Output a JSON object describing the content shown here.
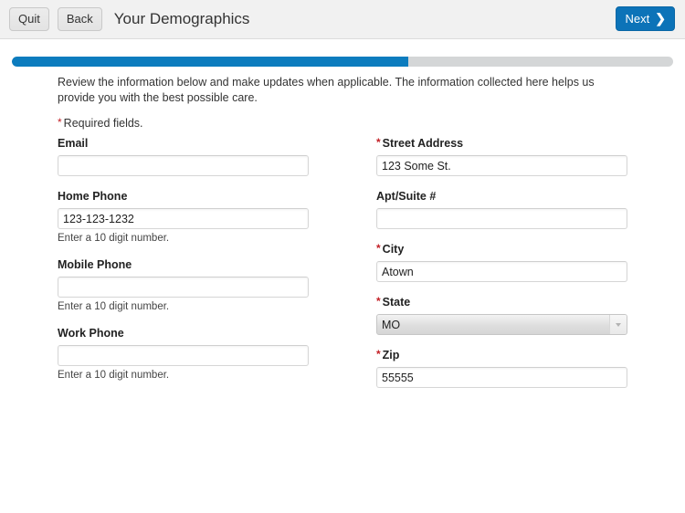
{
  "header": {
    "quit_label": "Quit",
    "back_label": "Back",
    "title": "Your Demographics",
    "next_label": "Next",
    "next_icon": "chevron-right-icon"
  },
  "progress": {
    "percent": 60,
    "fill_color": "#0c7cbe",
    "track_color": "#d4d6d7"
  },
  "intro": {
    "text": "Review the information below and make updates when applicable. The information collected here helps us provide you with the best possible care.",
    "required_note": "Required fields.",
    "required_marker": "*",
    "required_color": "#c32026"
  },
  "left_column": {
    "fields": [
      {
        "label": "Email",
        "required": false,
        "value": "",
        "placeholder": "",
        "helper": ""
      },
      {
        "label": "Home Phone",
        "required": false,
        "value": "123-123-1232",
        "placeholder": "",
        "helper": "Enter a 10 digit number."
      },
      {
        "label": "Mobile Phone",
        "required": false,
        "value": "",
        "placeholder": "",
        "helper": "Enter a 10 digit number."
      },
      {
        "label": "Work Phone",
        "required": false,
        "value": "",
        "placeholder": "",
        "helper": "Enter a 10 digit number."
      }
    ]
  },
  "right_column": {
    "fields": [
      {
        "label": "Street Address",
        "required": true,
        "value": "123 Some St.",
        "placeholder": "",
        "helper": ""
      },
      {
        "label": "Apt/Suite #",
        "required": false,
        "value": "",
        "placeholder": "",
        "helper": ""
      },
      {
        "label": "City",
        "required": true,
        "value": "Atown",
        "placeholder": "",
        "helper": ""
      },
      {
        "label": "State",
        "required": true,
        "value": "MO",
        "type": "select",
        "options": [
          "MO"
        ],
        "helper": ""
      },
      {
        "label": "Zip",
        "required": true,
        "value": "55555",
        "placeholder": "",
        "helper": ""
      }
    ]
  }
}
